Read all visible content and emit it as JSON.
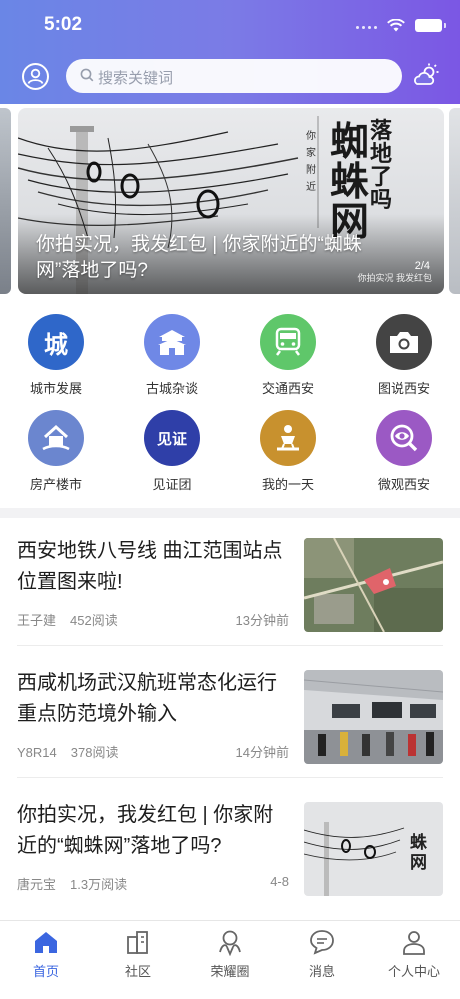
{
  "status_bar": {
    "time": "5:02"
  },
  "header": {
    "search_placeholder": "搜索关键词"
  },
  "banner": {
    "caption": "你拍实况，我发红包 | 你家附近的“蜘蛛网”落地了吗?",
    "poster_title": "蜘蛛网",
    "poster_subtitle": "落地了吗",
    "poster_small": "你家附近",
    "poster_footer": "你拍实况 我发红包",
    "pager": "2/4"
  },
  "categories": [
    {
      "label": "城市发展",
      "glyph": "城",
      "color": "#2f67c9",
      "icon": "city-icon"
    },
    {
      "label": "古城杂谈",
      "glyph": "",
      "color": "#6f88e6",
      "icon": "ancient-gate-icon"
    },
    {
      "label": "交通西安",
      "glyph": "",
      "color": "#5fc76a",
      "icon": "train-icon"
    },
    {
      "label": "图说西安",
      "glyph": "",
      "color": "#444444",
      "icon": "camera-icon"
    },
    {
      "label": "房产楼市",
      "glyph": "",
      "color": "#6b86cf",
      "icon": "house-icon"
    },
    {
      "label": "见证团",
      "glyph": "见证",
      "color": "#2f3fa8",
      "icon": "witness-icon"
    },
    {
      "label": "我的一天",
      "glyph": "",
      "color": "#c8912e",
      "icon": "person-day-icon"
    },
    {
      "label": "微观西安",
      "glyph": "",
      "color": "#9b59c4",
      "icon": "eye-magnifier-icon"
    }
  ],
  "news": [
    {
      "title": "西安地铁八号线 曲江范围站点位置图来啦!",
      "author": "王子建",
      "reads": "452阅读",
      "time": "13分钟前",
      "thumb": "map"
    },
    {
      "title": "西咸机场武汉航班常态化运行 重点防范境外输入",
      "author": "Y8R14",
      "reads": "378阅读",
      "time": "14分钟前",
      "thumb": "airport"
    },
    {
      "title": "你拍实况，我发红包 | 你家附近的“蜘蛛网”落地了吗?",
      "author": "唐元宝",
      "reads": "1.3万阅读",
      "time": "4-8",
      "thumb": "poster"
    }
  ],
  "tabbar": [
    {
      "label": "首页",
      "icon": "home-icon",
      "active": true
    },
    {
      "label": "社区",
      "icon": "buildings-icon",
      "active": false
    },
    {
      "label": "荣耀圈",
      "icon": "honor-circle-icon",
      "active": false
    },
    {
      "label": "消息",
      "icon": "message-icon",
      "active": false
    },
    {
      "label": "个人中心",
      "icon": "person-icon",
      "active": false
    }
  ],
  "colors": {
    "header_start": "#6a86e6",
    "header_end": "#7b57e4",
    "accent": "#3b66e0"
  }
}
